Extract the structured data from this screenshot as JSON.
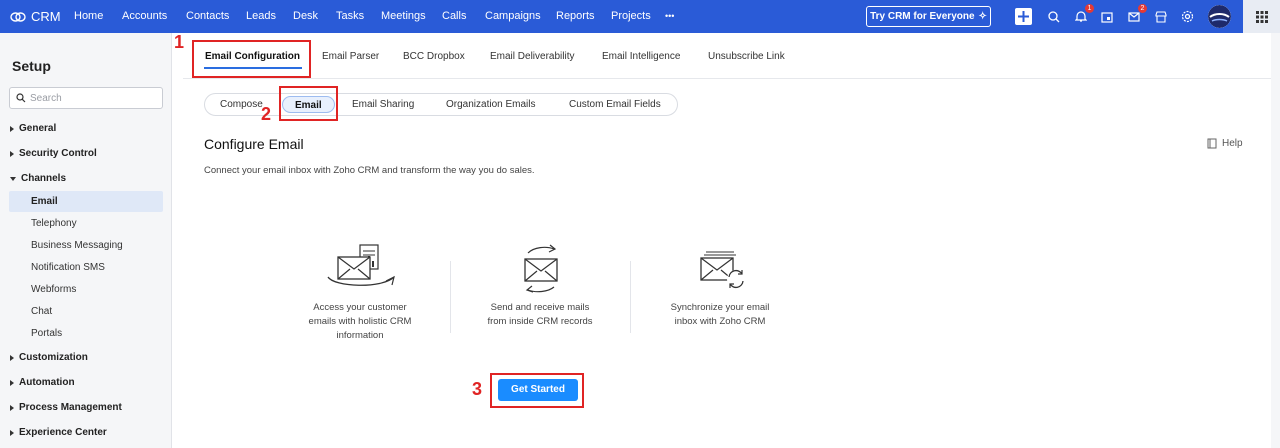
{
  "topbar": {
    "app_name": "CRM",
    "nav": [
      "Home",
      "Accounts",
      "Contacts",
      "Leads",
      "Desk",
      "Tasks",
      "Meetings",
      "Calls",
      "Campaigns",
      "Reports",
      "Projects"
    ],
    "more": "•••",
    "try_button": "Try CRM for Everyone",
    "notifications_count": "1",
    "messages_count": "2",
    "accent": "#2a5bd7"
  },
  "sidebar": {
    "title": "Setup",
    "search_placeholder": "Search",
    "sections": {
      "general": "General",
      "security": "Security Control",
      "channels": "Channels",
      "customization": "Customization",
      "automation": "Automation",
      "process": "Process Management",
      "experience": "Experience Center"
    },
    "channels_items": [
      "Email",
      "Telephony",
      "Business Messaging",
      "Notification SMS",
      "Webforms",
      "Chat",
      "Portals"
    ]
  },
  "main": {
    "tabs": [
      "Email Configuration",
      "Email Parser",
      "BCC Dropbox",
      "Email Deliverability",
      "Email Intelligence",
      "Unsubscribe Link"
    ],
    "subtabs": [
      "Compose",
      "Email",
      "Email Sharing",
      "Organization Emails",
      "Custom Email Fields"
    ],
    "title": "Configure Email",
    "help": "Help",
    "description": "Connect your email inbox with Zoho CRM and transform the way you do sales.",
    "features": [
      {
        "icon": "email-records-icon",
        "line1": "Access your customer",
        "line2": "emails with holistic CRM",
        "line3": "information"
      },
      {
        "icon": "email-send-receive-icon",
        "line1": "Send and receive mails",
        "line2": "from inside CRM records",
        "line3": ""
      },
      {
        "icon": "email-sync-icon",
        "line1": "Synchronize your email",
        "line2": "inbox with Zoho CRM",
        "line3": ""
      }
    ],
    "get_started": "Get Started"
  },
  "annotations": {
    "step1": "1",
    "step2": "2",
    "step3": "3",
    "color": "#e02424"
  }
}
